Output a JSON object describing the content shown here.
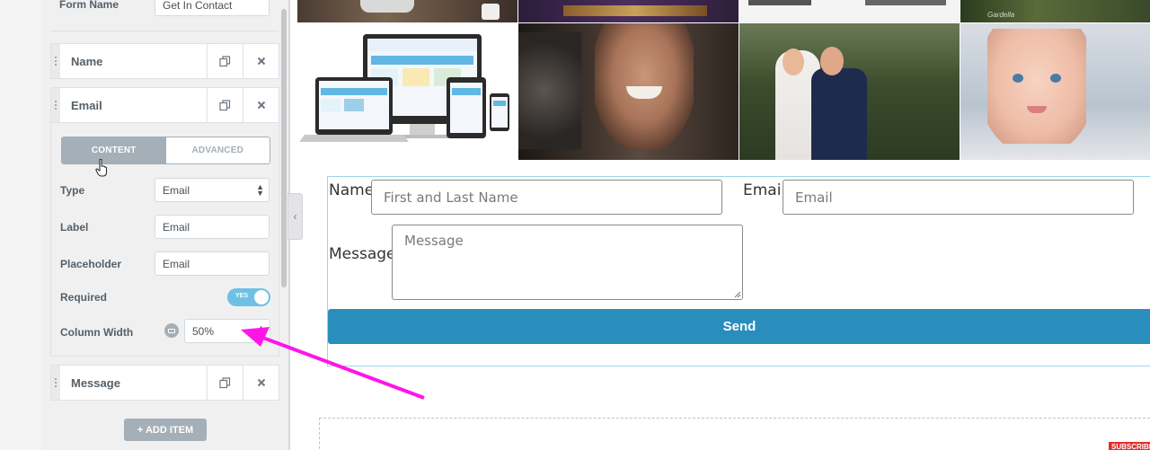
{
  "panel": {
    "form_name_label": "Form Name",
    "form_name_value": "Get In Contact",
    "items": [
      {
        "title": "Name"
      },
      {
        "title": "Email"
      },
      {
        "title": "Message"
      }
    ],
    "tabs": {
      "content": "CONTENT",
      "advanced": "ADVANCED"
    },
    "controls": {
      "type_label": "Type",
      "type_value": "Email",
      "label_label": "Label",
      "label_value": "Email",
      "placeholder_label": "Placeholder",
      "placeholder_value": "Email",
      "required_label": "Required",
      "required_toggle": "YES",
      "column_width_label": "Column Width",
      "column_width_value": "50%"
    },
    "add_item": "+ ADD ITEM"
  },
  "icons": {
    "duplicate": "duplicate-icon",
    "remove": "close-icon",
    "collapse": "chevron-left-icon",
    "device": "desktop-icon"
  },
  "form": {
    "name_label": "Name",
    "name_placeholder": "First and Last Name",
    "email_label": "Email",
    "email_placeholder": "Email",
    "message_label": "Message",
    "message_placeholder": "Message",
    "send": "Send"
  },
  "gallery": {
    "top_row_caption": "Gardella"
  },
  "badge": {
    "subscribe": "SUBSCRIBE"
  },
  "colors": {
    "accent": "#2a8ebd",
    "toggle_on": "#6ec1e4",
    "annotation_arrow": "#ff14e8",
    "panel_bg": "#f0f0f1"
  }
}
